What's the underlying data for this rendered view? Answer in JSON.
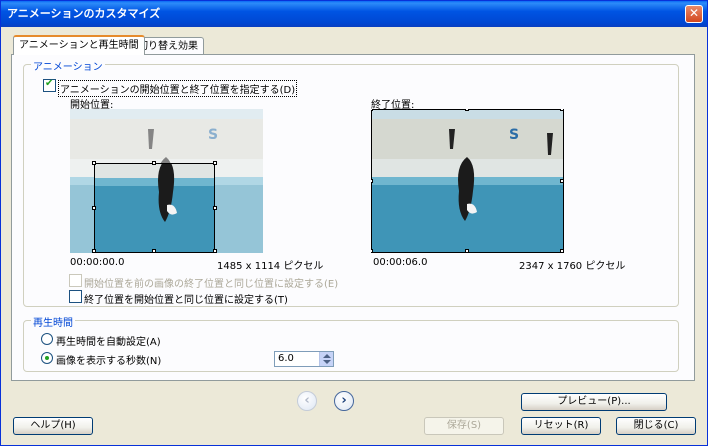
{
  "window": {
    "title": "アニメーションのカスタマイズ",
    "close_glyph": "✕"
  },
  "tabs": [
    {
      "label": "アニメーションと再生時間",
      "active": true
    },
    {
      "label": "切り替え効果",
      "active": false
    }
  ],
  "animation": {
    "legend": "アニメーション",
    "specify_label": "アニメーションの開始位置と終了位置を指定する(D)",
    "specify_checked": true,
    "start": {
      "label": "開始位置:",
      "time": "00:00:00.0",
      "size": "1485 x 1114 ピクセル"
    },
    "end": {
      "label": "終了位置:",
      "time": "00:00:06.0",
      "size": "2347 x 1760 ピクセル"
    },
    "prev_end_label": "開始位置を前の画像の終了位置と同じ位置に設定する(E)",
    "same_as_start_label": "終了位置を開始位置と同じ位置に設定する(T)"
  },
  "duration": {
    "legend": "再生時間",
    "auto_label": "再生時間を自動設定(A)",
    "seconds_label": "画像を表示する秒数(N)",
    "seconds_value": "6.0"
  },
  "nav": {
    "prev_glyph": "‹",
    "next_glyph": "›"
  },
  "buttons": {
    "preview": "プレビュー(P)...",
    "help": "ヘルプ(H)",
    "save": "保存(S)",
    "reset": "リセット(R)",
    "close": "閉じる(C)"
  },
  "colors": {
    "accent": "#0054e3",
    "legend": "#0046d5",
    "check": "#21a121"
  }
}
